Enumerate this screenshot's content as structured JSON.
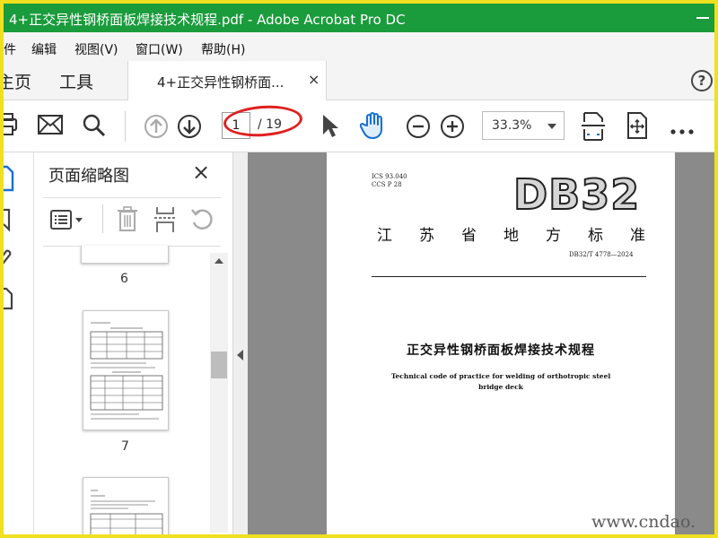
{
  "window": {
    "title": "4+正交异性钢桥面板焊接技术规程.pdf - Adobe Acrobat Pro DC"
  },
  "menu": [
    "件",
    "编辑",
    "视图(V)",
    "窗口(W)",
    "帮助(H)"
  ],
  "tabs": {
    "home": "主页",
    "tools": "工具",
    "document": "4+正交异性钢桥面...",
    "close_symbol": "×",
    "help_symbol": "?"
  },
  "toolbar": {
    "current_page": "1",
    "total_pages": "/ 19",
    "zoom": "33.3%",
    "icons": [
      "print-icon",
      "email-icon",
      "search-icon",
      "page-up-icon",
      "page-down-icon",
      "select-arrow-icon",
      "hand-icon",
      "zoom-out-icon",
      "zoom-in-icon",
      "fit-page-icon",
      "full-screen-icon",
      "more-icon"
    ]
  },
  "thumbnails_pane": {
    "title": "页面缩略图",
    "close_symbol": "×",
    "pages": [
      "6",
      "7"
    ]
  },
  "document": {
    "ics": "ICS 93.040",
    "ccs": "CCS P 28",
    "logo": "DB32",
    "org_chars": [
      "江",
      "苏",
      "省",
      "地",
      "方",
      "标",
      "准"
    ],
    "std_number": "DB32/T 4778—2024",
    "title_cn": "正交异性钢桥面板焊接技术规程",
    "title_en_line1": "Technical code of practice for welding of orthotropic steel",
    "title_en_line2": "bridge deck"
  },
  "watermark": "www.cndao."
}
